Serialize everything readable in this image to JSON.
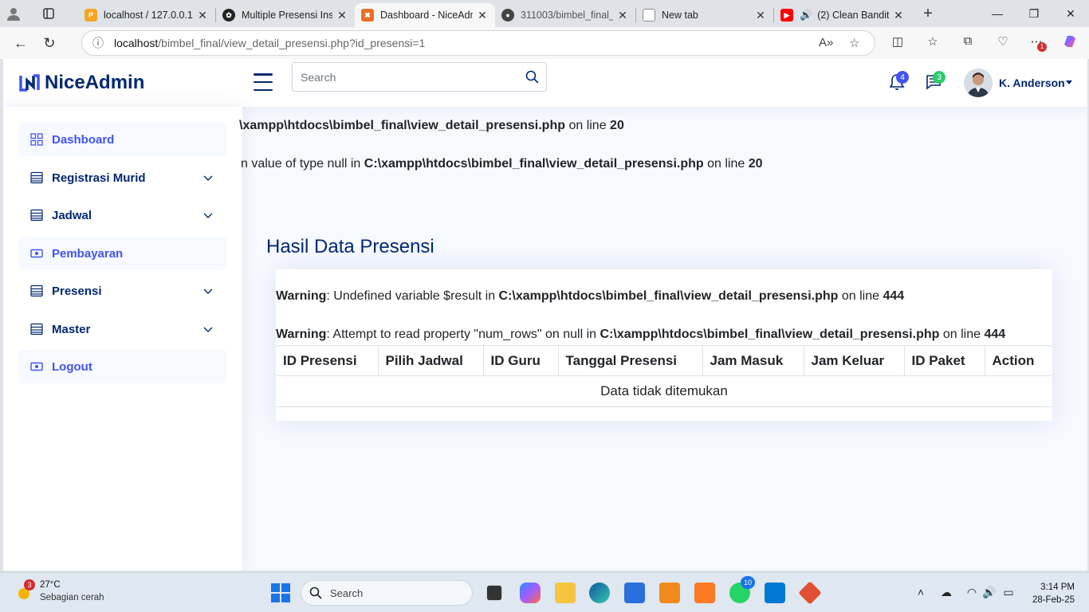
{
  "browser": {
    "tabs": [
      {
        "title": "localhost / 127.0.0.1 /",
        "fav_color": "#f5a623",
        "active": false
      },
      {
        "title": "Multiple Presensi Inse",
        "fav_color": "#222222",
        "active": false
      },
      {
        "title": "Dashboard - NiceAdm",
        "fav_color": "#e8702a",
        "active": true
      },
      {
        "title": "311003/bimbel_final_",
        "fav_color": "#333333",
        "active": false
      },
      {
        "title": "New tab",
        "fav_color": "#888888",
        "active": false
      },
      {
        "title": "(2) Clean Bandit",
        "fav_color": "#ff0000",
        "active": false
      }
    ],
    "url_host": "localhost",
    "url_path": "/bimbel_final/view_detail_presensi.php?id_presensi=1",
    "ext_badge": "1"
  },
  "header": {
    "logo_text": "NiceAdmin",
    "search_placeholder": "Search",
    "notif_count": "4",
    "msg_count": "3",
    "user_name": "K. Anderson"
  },
  "sidebar": {
    "items": [
      {
        "label": "Dashboard",
        "icon": "grid-icon"
      },
      {
        "label": "Registrasi Murid",
        "icon": "menu-icon"
      },
      {
        "label": "Jadwal",
        "icon": "menu-icon"
      },
      {
        "label": "Pembayaran",
        "icon": "cash-icon"
      },
      {
        "label": "Presensi",
        "icon": "menu-icon"
      },
      {
        "label": "Master",
        "icon": "menu-icon"
      },
      {
        "label": "Logout",
        "icon": "cash-icon"
      }
    ]
  },
  "main": {
    "top_warnings": [
      {
        "pre": "",
        "bold_path": "\\xampp\\htdocs\\bimbel_final\\view_detail_presensi.php",
        "mid": " on line ",
        "line": "20"
      },
      {
        "pre": "n value of type null in ",
        "bold_path": "C:\\xampp\\htdocs\\bimbel_final\\view_detail_presensi.php",
        "mid": " on line ",
        "line": "20"
      }
    ],
    "title": "Hasil Data Presensi",
    "card_warnings": [
      {
        "label": "Warning",
        "msg": ": Undefined variable $result in ",
        "path": "C:\\xampp\\htdocs\\bimbel_final\\view_detail_presensi.php",
        "mid": " on line ",
        "line": "444"
      },
      {
        "label": "Warning",
        "msg": ": Attempt to read property \"num_rows\" on null in ",
        "path": "C:\\xampp\\htdocs\\bimbel_final\\view_detail_presensi.php",
        "mid": " on line ",
        "line": "444"
      }
    ],
    "table": {
      "columns": [
        "ID Presensi",
        "Pilih Jadwal",
        "ID Guru",
        "Tanggal Presensi",
        "Jam Masuk",
        "Jam Keluar",
        "ID Paket",
        "Action"
      ],
      "empty_message": "Data tidak ditemukan"
    }
  },
  "taskbar": {
    "weather_temp": "27°C",
    "weather_desc": "Sebagian cerah",
    "weather_badge": "3",
    "search_label": "Search",
    "whatsapp_badge": "10",
    "time": "3:14 PM",
    "date": "28-Feb-25"
  }
}
